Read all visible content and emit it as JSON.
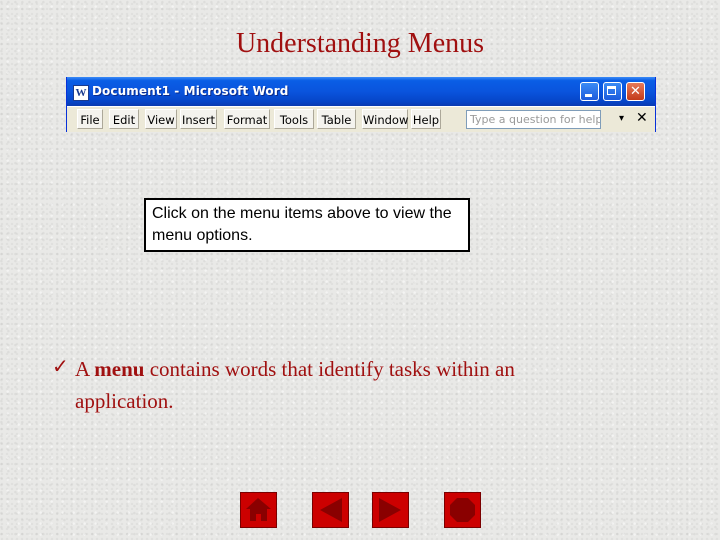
{
  "slide": {
    "title": "Understanding Menus",
    "callout_text": "Click on the menu items above to view the menu options.",
    "bullet": {
      "mark": "✓",
      "prefix": "A ",
      "term": "menu",
      "rest": " contains words that identify tasks within an application."
    },
    "accent_color": "#a01010",
    "nav_button_color": "#cc0000"
  },
  "window": {
    "title": "Document1 - Microsoft Word",
    "icon": "W",
    "menu": [
      {
        "label": "File"
      },
      {
        "label": "Edit"
      },
      {
        "label": "View"
      },
      {
        "label": "Insert"
      },
      {
        "label": "Format"
      },
      {
        "label": "Tools"
      },
      {
        "label": "Table"
      },
      {
        "label": "Window"
      },
      {
        "label": "Help"
      }
    ],
    "help_placeholder": "Type a question for help",
    "help_dropdown": "▾",
    "doc_close": "✕",
    "minimize_icon": "minimize-icon",
    "maximize_icon": "maximize-icon",
    "close_glyph": "✕"
  },
  "nav": {
    "home_icon": "home-icon",
    "back_icon": "back-arrow-icon",
    "forward_icon": "forward-arrow-icon",
    "end_icon": "stop-icon"
  }
}
